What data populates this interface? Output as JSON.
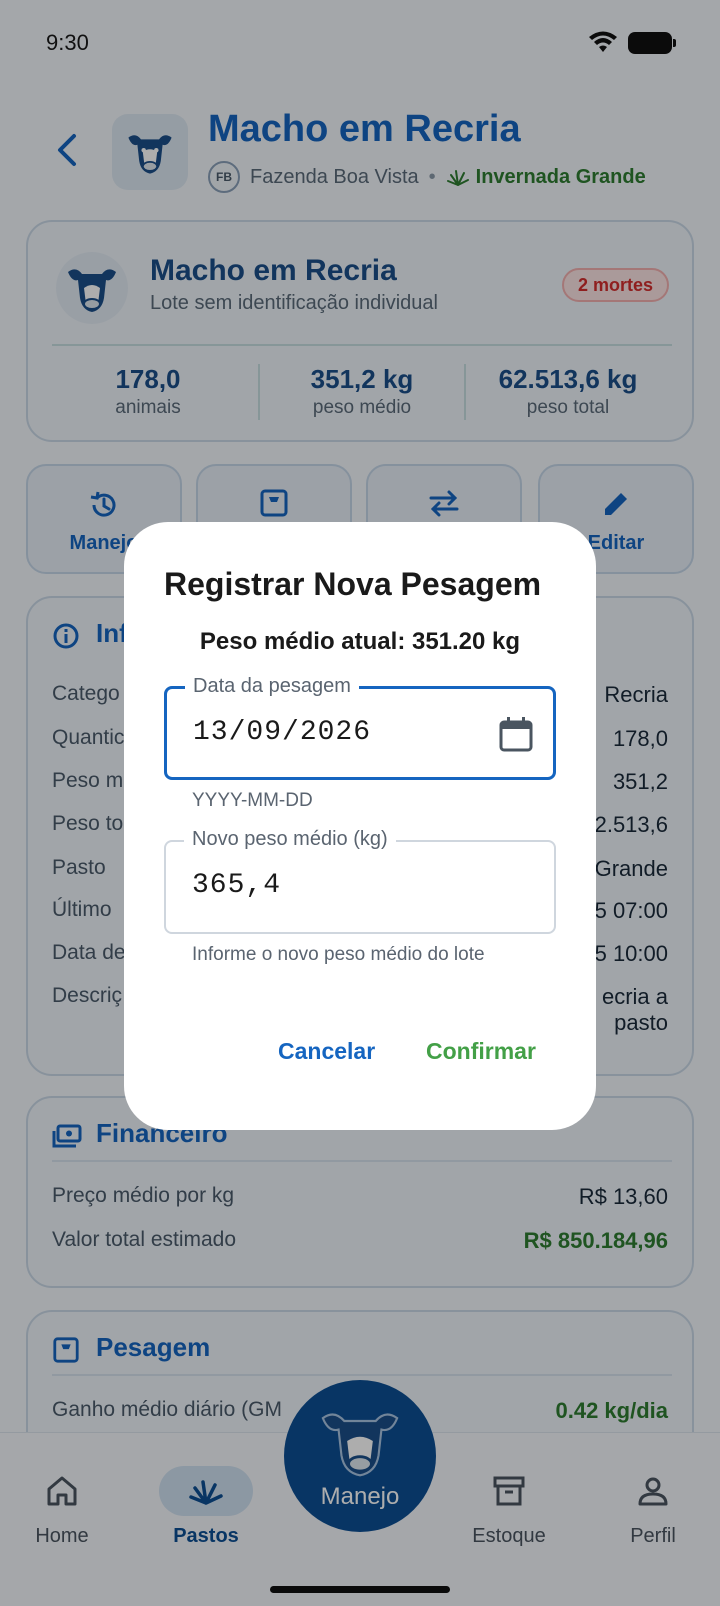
{
  "status_bar": {
    "time": "9:30"
  },
  "header": {
    "title": "Macho em Recria",
    "farm_initials": "FB",
    "farm_name": "Fazenda Boa Vista",
    "separator": "•",
    "pasture_name": "Invernada Grande"
  },
  "lote": {
    "name": "Macho em Recria",
    "description": "Lote sem identificação individual",
    "deaths_badge": "2 mortes",
    "stats": [
      {
        "value": "178,0",
        "label": "animais"
      },
      {
        "value": "351,2 kg",
        "label": "peso médio"
      },
      {
        "value": "62.513,6 kg",
        "label": "peso total"
      }
    ]
  },
  "actions": [
    {
      "label": "Manejo",
      "icon": "history-icon"
    },
    {
      "label": "",
      "icon": "scale-icon"
    },
    {
      "label": "",
      "icon": "transfer-icon"
    },
    {
      "label": "Editar",
      "icon": "edit-icon"
    }
  ],
  "info": {
    "title": "Inf",
    "rows": [
      {
        "label": "Catego",
        "value": "Recria"
      },
      {
        "label": "Quantic",
        "value": "178,0"
      },
      {
        "label": "Peso m",
        "value": "351,2"
      },
      {
        "label": "Peso to",
        "value": "2.513,6"
      },
      {
        "label": "Pasto",
        "value": "Grande"
      },
      {
        "label": "Último",
        "value": "5 07:00"
      },
      {
        "label": "Data de",
        "value": "5 10:00"
      },
      {
        "label": "Descriç",
        "value": "ecria a pasto"
      }
    ]
  },
  "financeiro": {
    "title": "Financeiro",
    "rows": [
      {
        "label": "Preço médio por kg",
        "value": "R$ 13,60"
      },
      {
        "label": "Valor total estimado",
        "value": "R$ 850.184,96"
      }
    ]
  },
  "pesagem": {
    "title": "Pesagem",
    "rows": [
      {
        "label": "Ganho médio diário (GM",
        "value": "0.42 kg/dia"
      }
    ]
  },
  "bottom_nav": {
    "items": [
      {
        "label": "Home",
        "icon": "home-icon"
      },
      {
        "label": "Pastos",
        "icon": "grass-icon"
      },
      {
        "label": "Estoque",
        "icon": "archive-icon"
      },
      {
        "label": "Perfil",
        "icon": "person-icon"
      }
    ],
    "fab_label": "Manejo"
  },
  "dialog": {
    "title": "Registrar Nova Pesagem",
    "current_weight": "Peso médio atual: 351.20 kg",
    "date_field": {
      "label": "Data da pesagem",
      "value": "13/09/2026",
      "helper": "YYYY-MM-DD"
    },
    "weight_field": {
      "label": "Novo peso médio (kg)",
      "value": "365,4",
      "helper": "Informe o novo peso médio do lote"
    },
    "cancel_label": "Cancelar",
    "confirm_label": "Confirmar"
  },
  "colors": {
    "primary": "#1565c0",
    "success": "#2e7d32",
    "danger": "#d32f2f",
    "fab": "#0d4f94",
    "confirm": "#43a047"
  }
}
